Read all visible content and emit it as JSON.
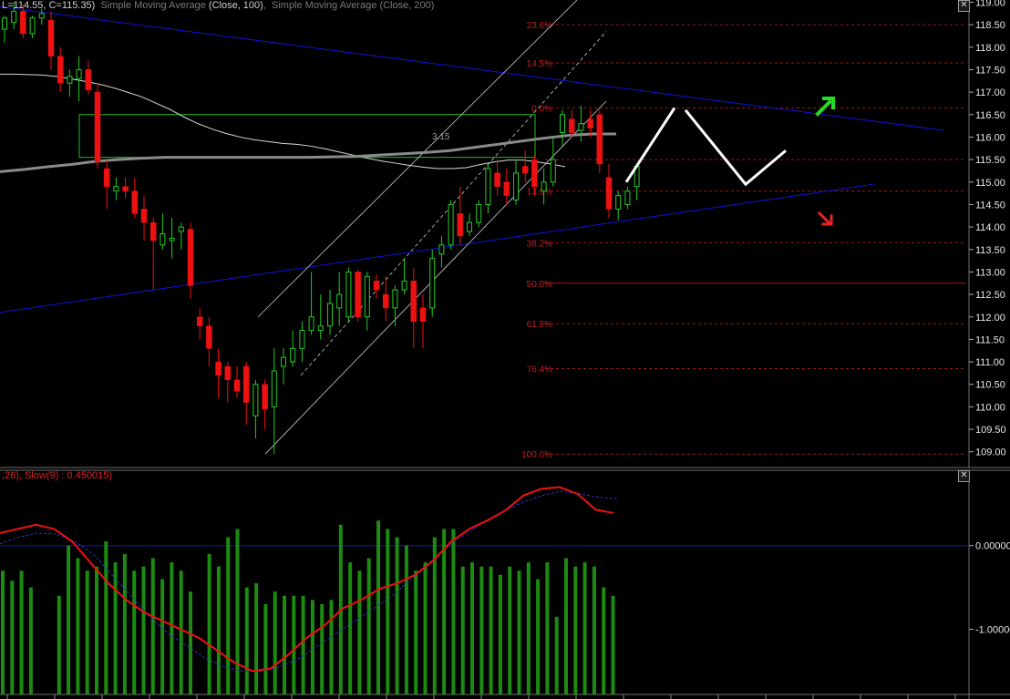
{
  "legend": {
    "price_readout": "L=114.55, C=115.35)",
    "sma1_label": "Simple Moving Average",
    "sma1_params": "(Close, 100)",
    "sma2_label": "Simple Moving Average",
    "sma2_params": "(Close, 200)"
  },
  "oscillator_legend": {
    "params_prefix": ",26), ",
    "slow_label": "Slow(9) : 0.450015)"
  },
  "close_symbol": "✕",
  "colors": {
    "background": "#000000",
    "bull_candle": "#22cc22",
    "bear_candle": "#ee1111",
    "trendline": "#1010dd",
    "channel": "#cccccc",
    "sma100": "#d8d8d8",
    "sma200": "#8a8a8a",
    "fib": "#9a1a1a",
    "box": "#20c020",
    "histogram": "#1d8a12",
    "macd": "#ee1111",
    "signal": "#3030c0",
    "up_arrow": "#22dd22",
    "down_arrow": "#ee2222",
    "projection": "#ffffff"
  },
  "chart_data": [
    {
      "type": "candlestick",
      "y_range": [
        108.65,
        119.05
      ],
      "y_ticks": [
        "119.00",
        "118.50",
        "118.00",
        "117.50",
        "117.00",
        "116.50",
        "116.00",
        "115.50",
        "115.00",
        "114.50",
        "114.00",
        "113.50",
        "113.00",
        "112.50",
        "112.00",
        "111.50",
        "111.00",
        "110.50",
        "110.00",
        "109.50",
        "109.00"
      ],
      "candles": [
        {
          "o": 118.4,
          "h": 118.7,
          "l": 118.1,
          "c": 118.65
        },
        {
          "o": 118.55,
          "h": 119.0,
          "l": 118.4,
          "c": 118.8
        },
        {
          "o": 118.8,
          "h": 118.95,
          "l": 118.2,
          "c": 118.3
        },
        {
          "o": 118.3,
          "h": 118.7,
          "l": 118.2,
          "c": 118.65
        },
        {
          "o": 118.65,
          "h": 118.85,
          "l": 118.5,
          "c": 118.75
        },
        {
          "o": 118.6,
          "h": 118.8,
          "l": 117.5,
          "c": 117.8
        },
        {
          "o": 117.8,
          "h": 118.0,
          "l": 117.0,
          "c": 117.2
        },
        {
          "o": 117.2,
          "h": 117.5,
          "l": 116.9,
          "c": 117.35
        },
        {
          "o": 117.3,
          "h": 117.8,
          "l": 116.8,
          "c": 117.5
        },
        {
          "o": 117.5,
          "h": 117.7,
          "l": 116.95,
          "c": 117.05
        },
        {
          "o": 117.0,
          "h": 117.2,
          "l": 115.3,
          "c": 115.45
        },
        {
          "o": 115.3,
          "h": 115.5,
          "l": 114.4,
          "c": 114.9
        },
        {
          "o": 114.8,
          "h": 115.1,
          "l": 114.6,
          "c": 114.9
        },
        {
          "o": 114.9,
          "h": 115.1,
          "l": 114.65,
          "c": 114.8
        },
        {
          "o": 114.8,
          "h": 115.1,
          "l": 114.2,
          "c": 114.3
        },
        {
          "o": 114.4,
          "h": 114.7,
          "l": 113.7,
          "c": 114.1
        },
        {
          "o": 114.1,
          "h": 114.2,
          "l": 112.6,
          "c": 113.7
        },
        {
          "o": 113.6,
          "h": 114.3,
          "l": 113.5,
          "c": 113.85
        },
        {
          "o": 113.7,
          "h": 114.2,
          "l": 113.3,
          "c": 113.75
        },
        {
          "o": 113.9,
          "h": 114.1,
          "l": 113.5,
          "c": 114.0
        },
        {
          "o": 113.95,
          "h": 114.1,
          "l": 112.4,
          "c": 112.7
        },
        {
          "o": 112.0,
          "h": 112.2,
          "l": 111.5,
          "c": 111.8
        },
        {
          "o": 111.8,
          "h": 112.0,
          "l": 110.9,
          "c": 111.3
        },
        {
          "o": 111.0,
          "h": 111.3,
          "l": 110.2,
          "c": 110.7
        },
        {
          "o": 110.9,
          "h": 111.0,
          "l": 110.1,
          "c": 110.6
        },
        {
          "o": 110.6,
          "h": 110.9,
          "l": 110.2,
          "c": 110.35
        },
        {
          "o": 110.9,
          "h": 111.0,
          "l": 109.6,
          "c": 110.1
        },
        {
          "o": 109.8,
          "h": 110.6,
          "l": 109.3,
          "c": 110.5
        },
        {
          "o": 110.5,
          "h": 110.6,
          "l": 109.5,
          "c": 109.95
        },
        {
          "o": 110.0,
          "h": 111.3,
          "l": 108.95,
          "c": 110.8
        },
        {
          "o": 110.9,
          "h": 111.3,
          "l": 110.5,
          "c": 111.1
        },
        {
          "o": 111.0,
          "h": 111.7,
          "l": 110.9,
          "c": 111.3
        },
        {
          "o": 111.3,
          "h": 111.9,
          "l": 111.0,
          "c": 111.7
        },
        {
          "o": 111.7,
          "h": 113.0,
          "l": 111.6,
          "c": 112.0
        },
        {
          "o": 111.7,
          "h": 112.5,
          "l": 111.5,
          "c": 111.8
        },
        {
          "o": 111.8,
          "h": 112.6,
          "l": 111.6,
          "c": 112.3
        },
        {
          "o": 112.2,
          "h": 113.0,
          "l": 111.8,
          "c": 112.5
        },
        {
          "o": 112.0,
          "h": 113.1,
          "l": 111.9,
          "c": 113.0
        },
        {
          "o": 113.0,
          "h": 113.05,
          "l": 111.9,
          "c": 112.0
        },
        {
          "o": 112.0,
          "h": 113.0,
          "l": 111.7,
          "c": 112.9
        },
        {
          "o": 112.8,
          "h": 112.95,
          "l": 112.4,
          "c": 112.6
        },
        {
          "o": 112.5,
          "h": 112.9,
          "l": 111.9,
          "c": 112.2
        },
        {
          "o": 112.2,
          "h": 112.7,
          "l": 111.8,
          "c": 112.6
        },
        {
          "o": 112.6,
          "h": 113.3,
          "l": 112.5,
          "c": 112.8
        },
        {
          "o": 112.8,
          "h": 113.1,
          "l": 111.3,
          "c": 111.9
        },
        {
          "o": 112.2,
          "h": 112.5,
          "l": 111.3,
          "c": 111.9
        },
        {
          "o": 112.2,
          "h": 113.5,
          "l": 112.0,
          "c": 113.3
        },
        {
          "o": 113.4,
          "h": 113.8,
          "l": 113.1,
          "c": 113.6
        },
        {
          "o": 113.6,
          "h": 114.6,
          "l": 113.5,
          "c": 114.5
        },
        {
          "o": 114.3,
          "h": 114.9,
          "l": 113.6,
          "c": 113.8
        },
        {
          "o": 113.9,
          "h": 114.3,
          "l": 113.8,
          "c": 114.1
        },
        {
          "o": 114.1,
          "h": 114.6,
          "l": 114.0,
          "c": 114.5
        },
        {
          "o": 114.5,
          "h": 115.4,
          "l": 114.3,
          "c": 115.3
        },
        {
          "o": 115.2,
          "h": 115.5,
          "l": 114.7,
          "c": 114.9
        },
        {
          "o": 115.0,
          "h": 115.3,
          "l": 114.5,
          "c": 114.7
        },
        {
          "o": 114.6,
          "h": 115.5,
          "l": 114.5,
          "c": 115.2
        },
        {
          "o": 115.35,
          "h": 115.7,
          "l": 115.0,
          "c": 115.2
        },
        {
          "o": 115.5,
          "h": 115.6,
          "l": 114.7,
          "c": 114.9
        },
        {
          "o": 114.8,
          "h": 115.3,
          "l": 114.5,
          "c": 115.0
        },
        {
          "o": 115.0,
          "h": 116.0,
          "l": 114.9,
          "c": 115.5
        },
        {
          "o": 116.1,
          "h": 116.6,
          "l": 115.8,
          "c": 116.5
        },
        {
          "o": 116.4,
          "h": 116.6,
          "l": 116.0,
          "c": 116.1
        },
        {
          "o": 116.15,
          "h": 116.7,
          "l": 115.9,
          "c": 116.3
        },
        {
          "o": 116.4,
          "h": 116.6,
          "l": 116.0,
          "c": 116.2
        },
        {
          "o": 116.5,
          "h": 116.6,
          "l": 115.2,
          "c": 115.4
        },
        {
          "o": 115.1,
          "h": 115.4,
          "l": 114.2,
          "c": 114.4
        },
        {
          "o": 114.4,
          "h": 114.8,
          "l": 114.15,
          "c": 114.7
        },
        {
          "o": 114.5,
          "h": 114.9,
          "l": 114.4,
          "c": 114.8
        },
        {
          "o": 114.9,
          "h": 115.4,
          "l": 114.6,
          "c": 115.35
        }
      ],
      "sma_100": [
        117.4,
        117.4,
        117.39,
        117.38,
        117.35,
        117.3,
        117.24,
        117.18,
        117.1,
        117.0,
        116.9,
        116.76,
        116.62,
        116.45,
        116.3,
        116.18,
        116.08,
        116.0,
        115.94,
        115.9,
        115.86,
        115.84,
        115.8,
        115.74,
        115.67,
        115.6,
        115.53,
        115.47,
        115.42,
        115.37,
        115.33,
        115.3,
        115.3,
        115.32,
        115.39,
        115.45,
        115.49,
        115.49,
        115.45,
        115.4,
        115.34
      ],
      "sma_200": [
        115.23,
        115.28,
        115.34,
        115.39,
        115.46,
        115.5,
        115.53,
        115.55,
        115.55,
        115.55,
        115.55,
        115.55,
        115.55,
        115.55,
        115.56,
        115.57,
        115.6,
        115.63,
        115.66,
        115.7,
        115.77,
        115.84,
        115.91,
        115.98,
        116.04,
        116.07,
        116.07
      ],
      "fib_levels": [
        {
          "label": "23.6%",
          "y": 118.5
        },
        {
          "label": "14.5%",
          "y": 117.65
        },
        {
          "label": "0.0%",
          "y": 116.65
        },
        {
          "label": "",
          "y": 115.5
        },
        {
          "label": "13.6%",
          "y": 114.8
        },
        {
          "label": "38.2%",
          "y": 113.65
        },
        {
          "label": "50.0%",
          "y": 112.75
        },
        {
          "label": "61.8%",
          "y": 111.85
        },
        {
          "label": "76.4%",
          "y": 110.85
        },
        {
          "label": "100.0%",
          "y": 108.95
        }
      ],
      "annotations": [
        {
          "text": "3.15"
        }
      ]
    },
    {
      "type": "histogram+lines",
      "y_range": [
        -1.78,
        0.88
      ],
      "y_ticks": [
        "0.00000",
        "-1.00000"
      ],
      "histogram": [
        -0.3,
        -0.42,
        -0.3,
        -0.5,
        null,
        null,
        -0.6,
        0.0,
        -0.15,
        -0.3,
        -0.25,
        0.05,
        -0.2,
        -0.1,
        -0.3,
        -0.25,
        -0.15,
        -0.4,
        -0.2,
        -0.3,
        -0.55,
        null,
        -0.1,
        -0.25,
        0.1,
        0.2,
        -0.5,
        -0.45,
        -0.7,
        -0.55,
        -0.6,
        -0.6,
        -0.6,
        -0.65,
        -0.7,
        -0.65,
        0.25,
        -0.2,
        -0.3,
        -0.15,
        0.3,
        0.2,
        0.1,
        0.0,
        -0.3,
        -0.2,
        0.1,
        0.2,
        0.2,
        -0.25,
        -0.2,
        -0.25,
        -0.25,
        -0.35,
        -0.25,
        -0.3,
        -0.2,
        -0.4,
        -0.2,
        -0.85,
        -0.15,
        -0.25,
        -0.2,
        -0.25,
        -0.5,
        -0.6
      ],
      "macd_line": [
        0.15,
        0.2,
        0.25,
        0.2,
        0.05,
        -0.2,
        -0.45,
        -0.65,
        -0.8,
        -0.9,
        -1.0,
        -1.1,
        -1.25,
        -1.4,
        -1.5,
        -1.47,
        -1.3,
        -1.1,
        -0.95,
        -0.75,
        -0.65,
        -0.52,
        -0.45,
        -0.35,
        -0.18,
        0.05,
        0.2,
        0.3,
        0.42,
        0.6,
        0.68,
        0.7,
        0.62,
        0.43,
        0.39
      ],
      "signal_line": [
        0.02,
        0.1,
        0.15,
        0.14,
        0.05,
        -0.1,
        -0.35,
        -0.6,
        -0.85,
        -1.05,
        -1.2,
        -1.35,
        -1.45,
        -1.5,
        -1.5,
        -1.45,
        -1.35,
        -1.2,
        -1.05,
        -0.9,
        -0.75,
        -0.6,
        -0.4,
        -0.2,
        0.0,
        0.15,
        0.3,
        0.42,
        0.52,
        0.6,
        0.65,
        0.62,
        0.58,
        0.56
      ]
    }
  ]
}
